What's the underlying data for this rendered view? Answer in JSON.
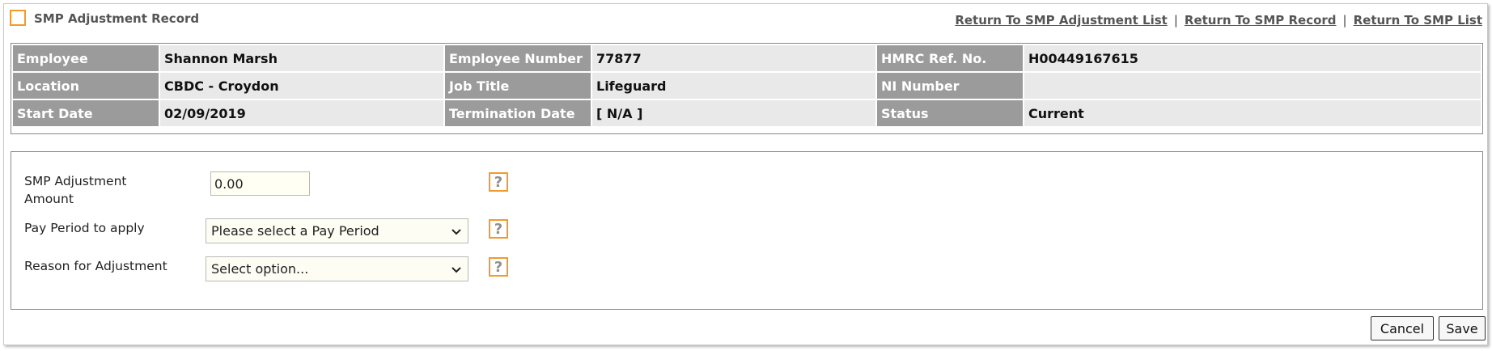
{
  "header": {
    "title": "SMP Adjustment Record",
    "links": [
      "Return To SMP Adjustment List",
      "Return To SMP Record",
      "Return To SMP List"
    ],
    "separator": "|"
  },
  "employee": {
    "rows": [
      [
        {
          "label": "Employee",
          "value": "Shannon Marsh"
        },
        {
          "label": "Employee Number",
          "value": "77877"
        },
        {
          "label": "HMRC Ref. No.",
          "value": "H00449167615"
        }
      ],
      [
        {
          "label": "Location",
          "value": "CBDC - Croydon"
        },
        {
          "label": "Job Title",
          "value": "Lifeguard"
        },
        {
          "label": "NI Number",
          "value": ""
        }
      ],
      [
        {
          "label": "Start Date",
          "value": "02/09/2019"
        },
        {
          "label": "Termination Date",
          "value": "[ N/A ]"
        },
        {
          "label": "Status",
          "value": "Current"
        }
      ]
    ]
  },
  "form": {
    "amount": {
      "label_line1": "SMP Adjustment",
      "label_line2": "Amount",
      "value": "0.00"
    },
    "pay_period": {
      "label": "Pay Period to apply",
      "selected": "Please select a Pay Period"
    },
    "reason": {
      "label": "Reason for Adjustment",
      "selected": "Select option..."
    },
    "help_glyph": "?"
  },
  "buttons": {
    "cancel": "Cancel",
    "save": "Save"
  },
  "colors": {
    "accent": "#f29a2e",
    "label_bg": "#9b9b9b",
    "value_bg": "#e9e9e9"
  },
  "icons": {
    "title": "square-outline-icon",
    "help": "help-question-icon",
    "dropdown": "chevron-down-icon"
  }
}
